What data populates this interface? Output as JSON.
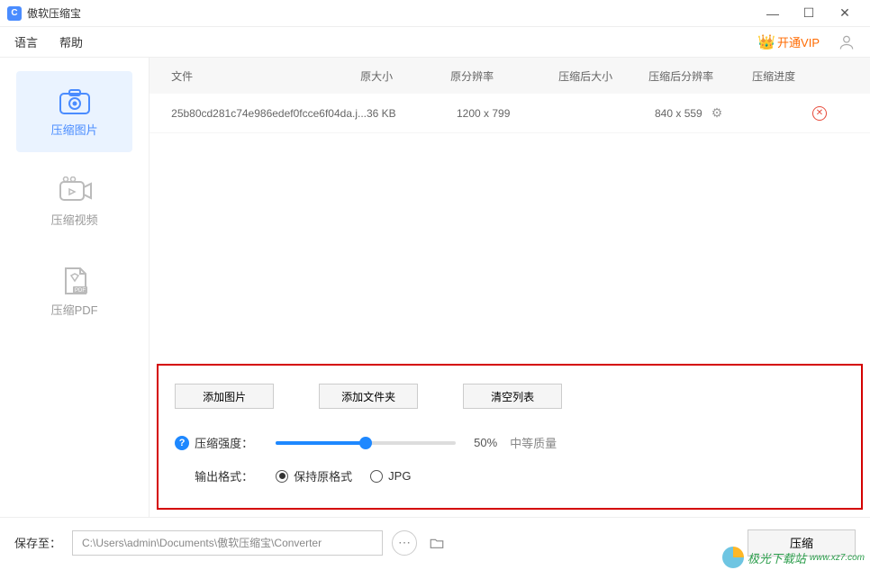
{
  "app": {
    "title": "傲软压缩宝"
  },
  "menu": {
    "lang": "语言",
    "help": "帮助",
    "vip": "开通VIP"
  },
  "sidebar": {
    "image": "压缩图片",
    "video": "压缩视频",
    "pdf": "压缩PDF"
  },
  "table": {
    "headers": {
      "file": "文件",
      "size": "原大小",
      "res": "原分辨率",
      "aftersize": "压缩后大小",
      "afterres": "压缩后分辨率",
      "progress": "压缩进度"
    },
    "rows": [
      {
        "file": "25b80cd281c74e986edef0fcce6f04da.j...",
        "size": "36 KB",
        "res": "1200 x 799",
        "aftersize": "",
        "afterres": "840 x 559"
      }
    ]
  },
  "controls": {
    "add_image": "添加图片",
    "add_folder": "添加文件夹",
    "clear_list": "清空列表",
    "strength_label": "压缩强度：",
    "strength_value": "50%",
    "strength_desc": "中等质量",
    "format_label": "输出格式：",
    "keep_original": "保持原格式",
    "jpg": "JPG"
  },
  "footer": {
    "save_label": "保存至：",
    "path": "C:\\Users\\admin\\Documents\\傲软压缩宝\\Converter",
    "compress": "压缩"
  },
  "watermark": "极光下载站"
}
